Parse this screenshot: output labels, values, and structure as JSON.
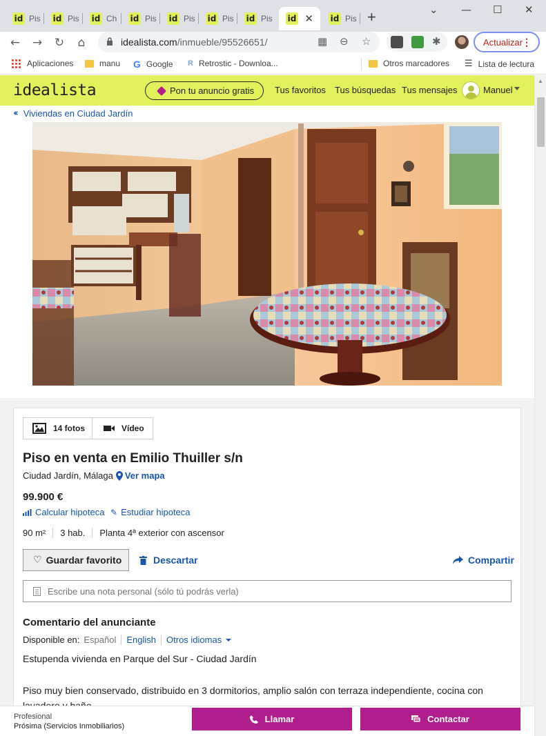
{
  "browser": {
    "tabs": [
      {
        "label": "Pis",
        "favicon": "id"
      },
      {
        "label": "Pis",
        "favicon": "id"
      },
      {
        "label": "Ch",
        "favicon": "id"
      },
      {
        "label": "Pis",
        "favicon": "id"
      },
      {
        "label": "Pis",
        "favicon": "id"
      },
      {
        "label": "Pis",
        "favicon": "id"
      },
      {
        "label": "Pis",
        "favicon": "id"
      },
      {
        "label": "",
        "favicon": "id",
        "active": true
      },
      {
        "label": "Pis",
        "favicon": "id"
      }
    ],
    "new_tab_label": "+",
    "url_domain": "idealista.com",
    "url_path": "/inmueble/95526651/",
    "update_label": "Actualizar",
    "bookmarks": {
      "apps": "Aplicaciones",
      "manu": "manu",
      "google": "Google",
      "retrostic": "Retrostic - Downloa...",
      "otros": "Otros marcadores",
      "lectura": "Lista de lectura"
    }
  },
  "header": {
    "logo": "idealista",
    "publish_label": "Pon tu anuncio gratis",
    "favorites": "Tus favoritos",
    "searches": "Tus búsquedas",
    "messages": "Tus mensajes",
    "user": "Manuel"
  },
  "breadcrumb": "Viviendas en Ciudad Jardín",
  "listing": {
    "photos_label": "14 fotos",
    "video_label": "Vídeo",
    "title": "Piso en venta en Emilio Thuiller s/n",
    "location": "Ciudad Jardín, Málaga",
    "map_link": "Ver mapa",
    "price": "99.900 €",
    "mortgage_calc": "Calcular hipoteca",
    "mortgage_study": "Estudiar hipoteca",
    "features": [
      "90 m²",
      "3 hab.",
      "Planta 4ª exterior con ascensor"
    ],
    "favorite_label": "Guardar favorito",
    "discard_label": "Descartar",
    "share_label": "Compartir",
    "note_placeholder": "Escribe una nota personal (sólo tú podrás verla)",
    "comment_title": "Comentario del anunciante",
    "available_in": "Disponible en:",
    "languages": [
      "Español",
      "English",
      "Otros idiomas"
    ],
    "description": [
      "Estupenda vivienda en Parque del Sur - Ciudad Jardín",
      "Piso muy bien conservado, distribuido en 3 dormitorios, amplio salón con terraza independiente, cocina con lavadero y baño"
    ]
  },
  "contact_bar": {
    "role": "Profesional",
    "agency": "Prósima (Servicios Inmobiliarios)",
    "call_label": "Llamar",
    "contact_label": "Contactar"
  },
  "colors": {
    "brand_yellow": "#e1f05b",
    "link_blue": "#1a56b0",
    "cta_magenta": "#b01e8d"
  }
}
